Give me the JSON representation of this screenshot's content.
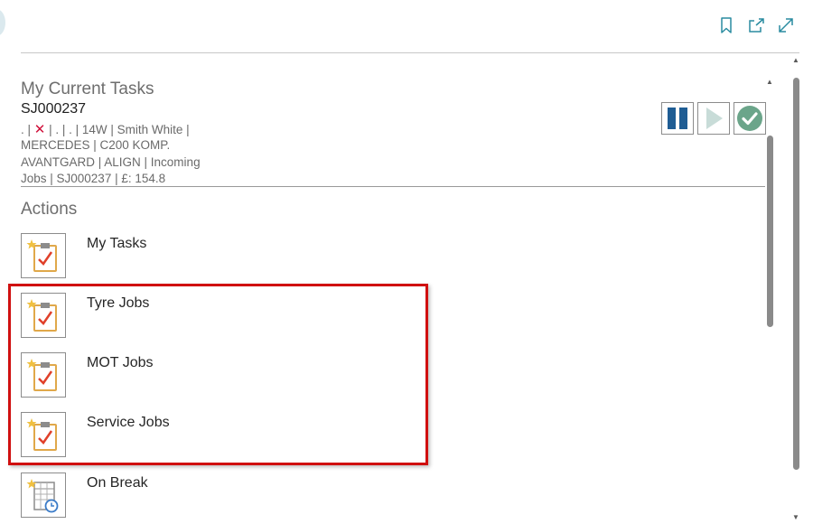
{
  "toolbar": {
    "bookmark_icon": "bookmark-icon",
    "open_new_icon": "open-in-new-window-icon",
    "expand_icon": "expand-icon",
    "accent_color": "#2a8ca0"
  },
  "current_tasks": {
    "title": "My Current Tasks",
    "task_id": "SJ000237",
    "line1_prefix": ". | ",
    "line1_suffix": " | . | . | 14W | Smith White |",
    "line2": "MERCEDES | C200 KOMP.",
    "line3": "AVANTGARD | ALIGN | Incoming",
    "line4": "Jobs | SJ000237 | £: 154.8",
    "x_icon": "cross-icon",
    "controls": [
      {
        "name": "pause",
        "icon": "pause-icon",
        "color": "#1f5d94"
      },
      {
        "name": "play",
        "icon": "play-icon",
        "color": "#c8dcd8"
      },
      {
        "name": "complete",
        "icon": "check-circle-icon",
        "color": "#6ba58a"
      }
    ]
  },
  "actions": {
    "title": "Actions",
    "items": [
      {
        "label": "My Tasks",
        "icon": "clipboard-check-icon"
      },
      {
        "label": "Tyre Jobs",
        "icon": "clipboard-check-icon"
      },
      {
        "label": "MOT Jobs",
        "icon": "clipboard-check-icon"
      },
      {
        "label": "Service Jobs",
        "icon": "clipboard-check-icon"
      },
      {
        "label": "On Break",
        "icon": "calendar-clock-icon"
      }
    ],
    "highlight_color": "#d01010"
  }
}
